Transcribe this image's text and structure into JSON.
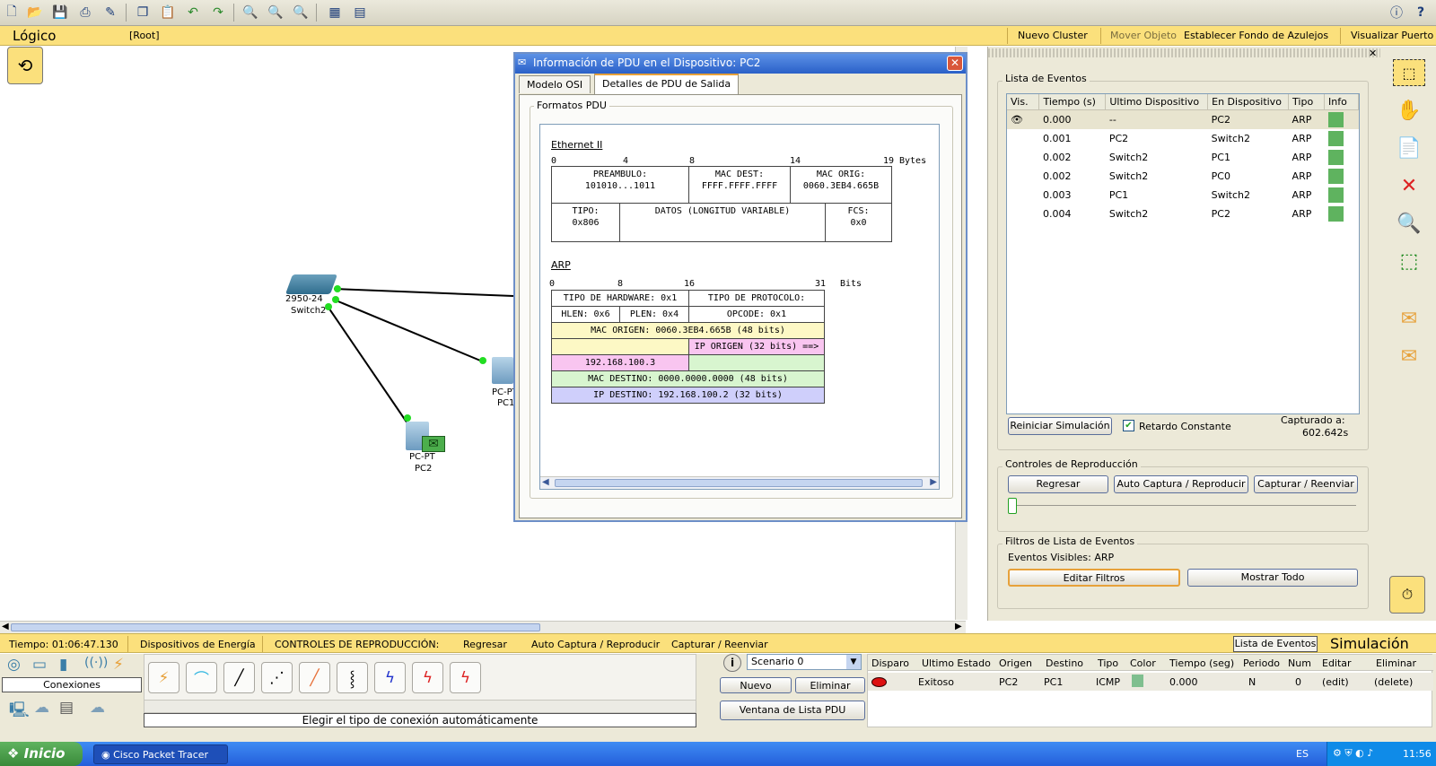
{
  "toolbar": {
    "icons": [
      "new-icon",
      "open-icon",
      "save-icon",
      "print-icon",
      "activity-wizard-icon",
      "copy-icon",
      "paste-icon",
      "undo-icon",
      "redo-icon",
      "zoom-in-icon",
      "zoom-reset-icon",
      "zoom-out-icon",
      "palette-icon",
      "custom-device-icon",
      "info-icon",
      "help-icon"
    ]
  },
  "nav": {
    "mode": "Lógico",
    "root": "[Root]",
    "new_cluster": "Nuevo Cluster",
    "move_object": "Mover Objeto",
    "set_tiled_bg": "Establecer Fondo de Azulejos",
    "viewport": "Visualizar Puerto"
  },
  "devices": [
    {
      "model": "2950-24",
      "name": "Switch2"
    },
    {
      "model": "PC-PT",
      "name": "PC1"
    },
    {
      "model": "PC-PT",
      "name": "PC2"
    }
  ],
  "pdu_window": {
    "title": "Información de PDU en el Dispositivo: PC2",
    "tabs": [
      "Modelo OSI",
      "Detalles de PDU de Salida"
    ],
    "group_label": "Formatos PDU",
    "ethernet": {
      "title": "Ethernet II",
      "ruler": [
        "0",
        "4",
        "8",
        "14",
        "19"
      ],
      "unit": "Bytes",
      "preamble": "PREAMBULO:\n101010...1011",
      "mac_dest": "MAC DEST:\nFFFF.FFFF.FFFF",
      "mac_orig": "MAC ORIG:\n0060.3EB4.665B",
      "tipo": "TIPO:\n0x806",
      "datos": "DATOS (LONGITUD VARIABLE)",
      "fcs": "FCS:\n0x0"
    },
    "arp": {
      "title": "ARP",
      "ruler": [
        "0",
        "8",
        "16",
        "31"
      ],
      "unit": "Bits",
      "hw_type": "TIPO DE HARDWARE: 0x1",
      "proto_type": "TIPO DE PROTOCOLO:",
      "hlen": "HLEN: 0x6",
      "plen": "PLEN: 0x4",
      "opcode": "OPCODE: 0x1",
      "mac_origen": "MAC ORIGEN: 0060.3EB4.665B (48 bits)",
      "ip_origen_label": "IP ORIGEN (32 bits) ==>",
      "ip_origen": "192.168.100.3",
      "mac_destino": "MAC DESTINO: 0000.0000.0000 (48 bits)",
      "ip_destino": "IP DESTINO: 192.168.100.2 (32 bits)"
    }
  },
  "event_list": {
    "title": "Lista de Eventos",
    "columns": [
      "Vis.",
      "Tiempo (s)",
      "Ultimo Dispositivo",
      "En Dispositivo",
      "Tipo",
      "Info"
    ],
    "rows": [
      {
        "time": "0.000",
        "last": "--",
        "at": "PC2",
        "type": "ARP"
      },
      {
        "time": "0.001",
        "last": "PC2",
        "at": "Switch2",
        "type": "ARP"
      },
      {
        "time": "0.002",
        "last": "Switch2",
        "at": "PC1",
        "type": "ARP"
      },
      {
        "time": "0.002",
        "last": "Switch2",
        "at": "PC0",
        "type": "ARP"
      },
      {
        "time": "0.003",
        "last": "PC1",
        "at": "Switch2",
        "type": "ARP"
      },
      {
        "time": "0.004",
        "last": "Switch2",
        "at": "PC2",
        "type": "ARP"
      }
    ],
    "reset_button": "Reiniciar Simulación",
    "constant_delay": "Retardo Constante",
    "captured_label": "Capturado a:",
    "captured_value": "602.642s"
  },
  "playback": {
    "title": "Controles de Reproducción",
    "back": "Regresar",
    "auto": "Auto Captura / Reproducir",
    "capture": "Capturar / Reenviar"
  },
  "filters": {
    "title": "Filtros de Lista de Eventos",
    "visible": "Eventos Visibles: ARP",
    "edit": "Editar Filtros",
    "show_all": "Mostrar Todo"
  },
  "status": {
    "time": "Tiempo: 01:06:47.130",
    "power": "Dispositivos de Energía",
    "controls": "CONTROLES DE REPRODUCCIÓN:",
    "back": "Regresar",
    "auto": "Auto Captura / Reproducir",
    "capture": "Capturar / Reenviar",
    "event_list_btn": "Lista de Eventos",
    "mode": "Simulación"
  },
  "devices_panel": {
    "category": "Conexiones",
    "hint": "Elegir el tipo de conexión automáticamente"
  },
  "scenario": {
    "selected": "Scenario 0",
    "new": "Nuevo",
    "delete": "Eliminar",
    "pdu_list": "Ventana de Lista PDU"
  },
  "pdu_table": {
    "columns": [
      "Disparo",
      "Ultimo Estado",
      "Origen",
      "Destino",
      "Tipo",
      "Color",
      "Tiempo (seg)",
      "Periodo",
      "Num",
      "Editar",
      "Eliminar"
    ],
    "row": {
      "status": "Exitoso",
      "source": "PC2",
      "dest": "PC1",
      "type": "ICMP",
      "color": "#7fbf8f",
      "time": "0.000",
      "period": "N",
      "num": "0",
      "edit": "(edit)",
      "delete": "(delete)"
    }
  },
  "taskbar": {
    "start": "Inicio",
    "app": "Cisco Packet Tracer",
    "lang": "ES",
    "clock": "11:56"
  },
  "colors": {
    "nav_yellow": "#fbe07c",
    "info_green": "#5fb35f",
    "pink": "#f9c5f0",
    "yellow_cell": "#fdf8c5",
    "green_cell": "#d8f5cf",
    "blue_cell": "#cfcffb"
  }
}
